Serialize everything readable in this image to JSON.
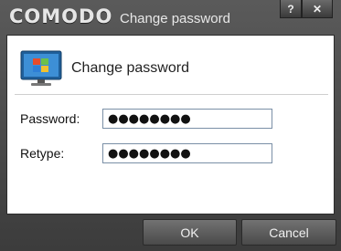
{
  "titlebar": {
    "brand": "COMODO",
    "title": "Change password",
    "help_label": "?",
    "close_label": "✕"
  },
  "header": {
    "title": "Change password",
    "icon": "monitor-windows-icon"
  },
  "form": {
    "password_label": "Password:",
    "password_value": "●●●●●●●●",
    "retype_label": "Retype:",
    "retype_value": "●●●●●●●●"
  },
  "buttons": {
    "ok_label": "OK",
    "cancel_label": "Cancel"
  },
  "colors": {
    "chrome": "#4a4a4a",
    "panel": "#ffffff",
    "field_border": "#7a8fa6"
  }
}
